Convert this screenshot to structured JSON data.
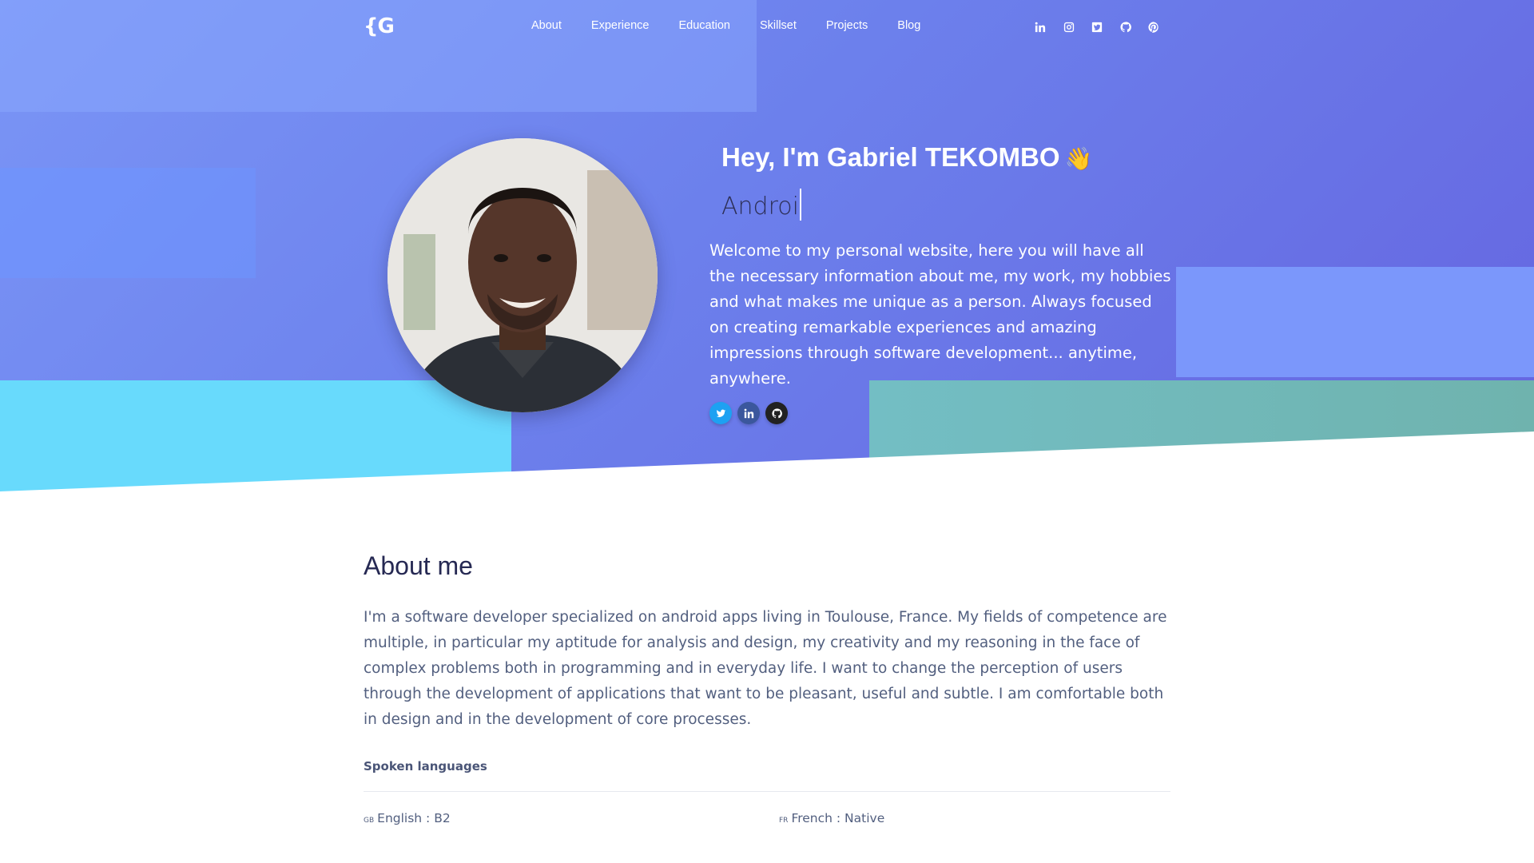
{
  "nav": {
    "logo": "{G",
    "links": [
      "About",
      "Experience",
      "Education",
      "Skillset",
      "Projects",
      "Blog"
    ],
    "social_icons": [
      "linkedin-icon",
      "instagram-icon",
      "twitter-icon",
      "github-icon",
      "pinterest-icon"
    ]
  },
  "hero": {
    "title": "Hey, I'm Gabriel TEKOMBO",
    "wave_emoji": "👋",
    "typed_text": "Androi",
    "description": "Welcome to my personal website, here you will have all the necessary information about me, my work, my hobbies and what makes me unique as a person. Always focused on creating remarkable experiences and amazing impressions through software development... anytime, anywhere.",
    "social_icons": [
      "twitter-icon",
      "linkedin-icon",
      "github-icon"
    ]
  },
  "about": {
    "title": "About me",
    "text": "I'm a software developer specialized on android apps living in Toulouse, France. My fields of competence are multiple, in particular my aptitude for analysis and design, my creativity and my reasoning in the face of complex problems both in programming and in everyday life. I want to change the perception of users through the development of applications that want to be pleasant, useful and subtle. I am comfortable both in design and in the development of core processes.",
    "languages_heading": "Spoken languages",
    "languages": [
      {
        "flag": "GB",
        "text": "English : B2"
      },
      {
        "flag": "FR",
        "text": "French : Native"
      }
    ]
  },
  "colors": {
    "hero_gradient_start": "#7a95f6",
    "hero_gradient_end": "#6565e0",
    "cyan_block": "#68dafc",
    "teal_block": "#6fb3ae",
    "heading_dark": "#262953",
    "body_text": "#525f7f",
    "twitter": "#1da1f2",
    "linkedin": "#3b579d",
    "github": "#222222"
  }
}
